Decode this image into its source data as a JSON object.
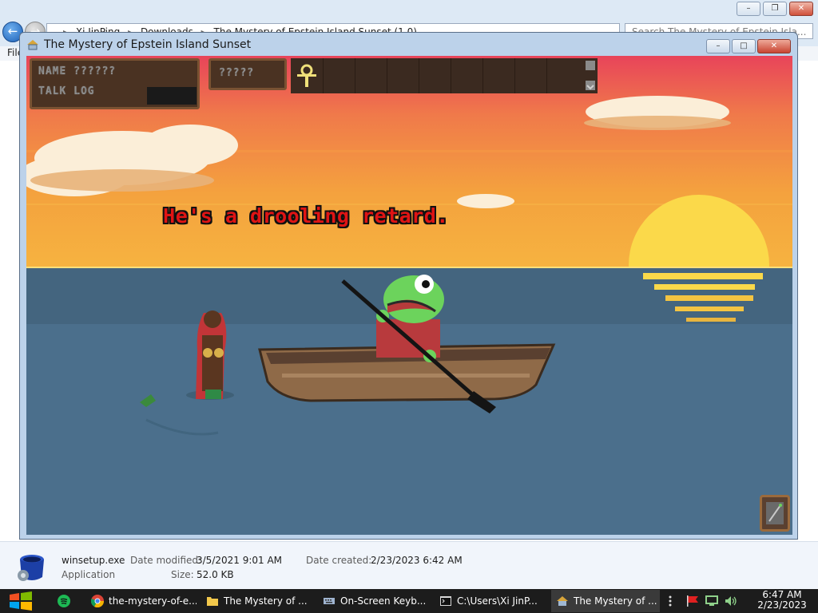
{
  "explorer": {
    "breadcrumb": [
      "Xi JinPing",
      "Downloads",
      "The Mystery of Epstein Island Sunset (1.0)"
    ],
    "search_placeholder": "Search The Mystery of Epstein Isla...",
    "menu_first": "File",
    "details": {
      "name": "winsetup.exe",
      "type": "Application",
      "modified_label": "Date modified:",
      "modified_value": "3/5/2021 9:01 AM",
      "created_label": "Date created:",
      "created_value": "2/23/2023 6:42 AM",
      "size_label": "Size:",
      "size_value": "52.0 KB"
    }
  },
  "game": {
    "window_title": "The Mystery of Epstein Island Sunset",
    "hud": {
      "row1": "NAME ??????",
      "row2": "TALK LOG",
      "mid": "?????"
    },
    "dialogue": "He's a drooling retard.",
    "colors": {
      "sky_top": "#e8445a",
      "sky_mid": "#f07a4a",
      "sky_bottom": "#f6b340",
      "sea": "#4b6f8c",
      "sun": "#fbd94a",
      "dialogue_text": "#e01414"
    }
  },
  "taskbar": {
    "items": [
      {
        "label": "",
        "icon": "spotify-icon"
      },
      {
        "label": "the-mystery-of-e...",
        "icon": "chrome-icon"
      },
      {
        "label": "The Mystery of ...",
        "icon": "folder-icon"
      },
      {
        "label": "On-Screen Keyb...",
        "icon": "keyboard-icon"
      },
      {
        "label": "C:\\Users\\Xi JinP...",
        "icon": "console-icon"
      },
      {
        "label": "The Mystery of ...",
        "icon": "game-icon"
      }
    ],
    "clock_time": "6:47 AM",
    "clock_date": "2/23/2023"
  }
}
